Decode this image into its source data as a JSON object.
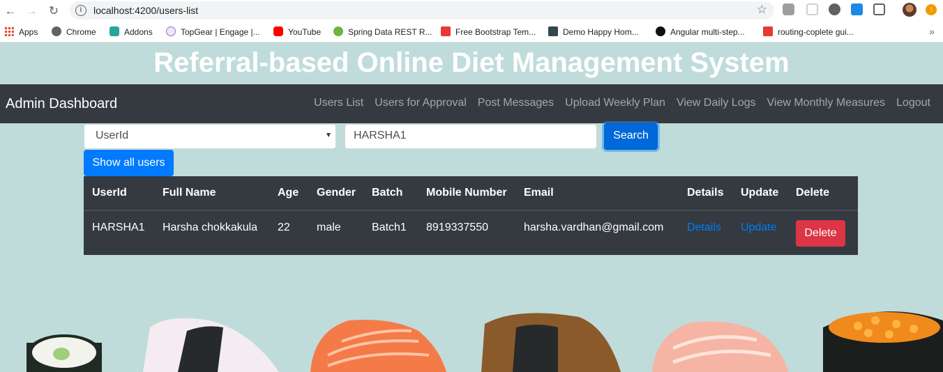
{
  "browser": {
    "url": "localhost:4200/users-list",
    "bookmarks": [
      "Apps",
      "Chrome",
      "Addons",
      "TopGear | Engage |...",
      "YouTube",
      "Spring Data REST R...",
      "Free Bootstrap Tem...",
      "Demo Happy Hom...",
      "Angular multi-step...",
      "routing-coplete gui..."
    ],
    "colors": {
      "youtube": "#ff0000",
      "spring": "#6db33f",
      "bootstrap": "#e53935"
    }
  },
  "page": {
    "title": "Referral-based Online Diet Management System",
    "background": "#bfdcda"
  },
  "navbar": {
    "brand": "Admin Dashboard",
    "links": [
      "Users List",
      "Users for Approval",
      "Post Messages",
      "Upload Weekly Plan",
      "View Daily Logs",
      "View Monthly Measures",
      "Logout"
    ]
  },
  "search": {
    "field_selected": "UserId",
    "value": "HARSHA1",
    "button": "Search",
    "show_all": "Show all users"
  },
  "table": {
    "headers": [
      "UserId",
      "Full Name",
      "Age",
      "Gender",
      "Batch",
      "Mobile Number",
      "Email",
      "Details",
      "Update",
      "Delete"
    ],
    "rows": [
      {
        "userid": "HARSHA1",
        "full_name": "Harsha chokkakula",
        "age": "22",
        "gender": "male",
        "batch": "Batch1",
        "mobile": "8919337550",
        "email": "harsha.vardhan@gmail.com",
        "details": "Details",
        "update": "Update",
        "delete": "Delete"
      }
    ]
  }
}
